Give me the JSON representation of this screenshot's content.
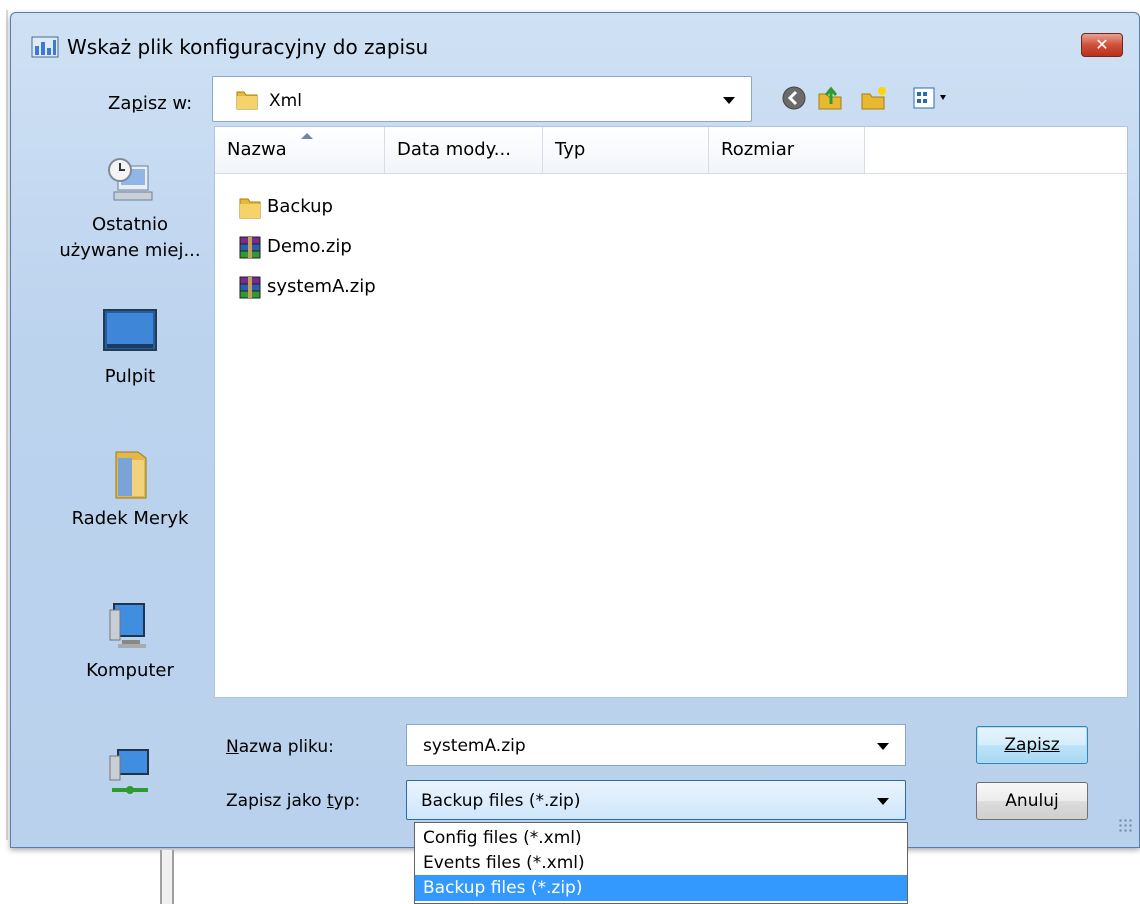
{
  "window": {
    "title": "Wskaż plik konfiguracyjny do zapisu",
    "close_glyph": "✕"
  },
  "lookin": {
    "label": "Zapisz w:",
    "value": "Xml"
  },
  "toolbar": [
    "back-icon",
    "up-folder-icon",
    "new-folder-icon",
    "views-menu-icon"
  ],
  "places": [
    {
      "label1": "Ostatnio",
      "label2": "używane miej...",
      "icon": "recent-places-icon"
    },
    {
      "label1": "Pulpit",
      "label2": "",
      "icon": "desktop-icon"
    },
    {
      "label1": "Radek Meryk",
      "label2": "",
      "icon": "user-folder-icon"
    },
    {
      "label1": "Komputer",
      "label2": "",
      "icon": "computer-icon"
    },
    {
      "label1": "",
      "label2": "",
      "icon": "network-icon"
    }
  ],
  "columns": [
    "Nazwa",
    "Data mody...",
    "Typ",
    "Rozmiar"
  ],
  "files": [
    {
      "name": "Backup",
      "icon": "folder-icon"
    },
    {
      "name": "Demo.zip",
      "icon": "winrar-archive-icon"
    },
    {
      "name": "systemA.zip",
      "icon": "winrar-archive-icon"
    }
  ],
  "filename": {
    "label": "Nazwa pliku:",
    "value": "systemA.zip"
  },
  "filetype": {
    "label": "Zapisz jako typ:",
    "value": "Backup files (*.zip)",
    "options": [
      "Config files (*.xml)",
      "Events files (*.xml)",
      "Backup files (*.zip)"
    ],
    "selected_index": 2
  },
  "buttons": {
    "save": "Zapisz",
    "cancel": "Anuluj"
  },
  "colors": {
    "selection": "#3399ff",
    "dialog_bg": "#bcd3ee",
    "close_red": "#c8412b"
  }
}
